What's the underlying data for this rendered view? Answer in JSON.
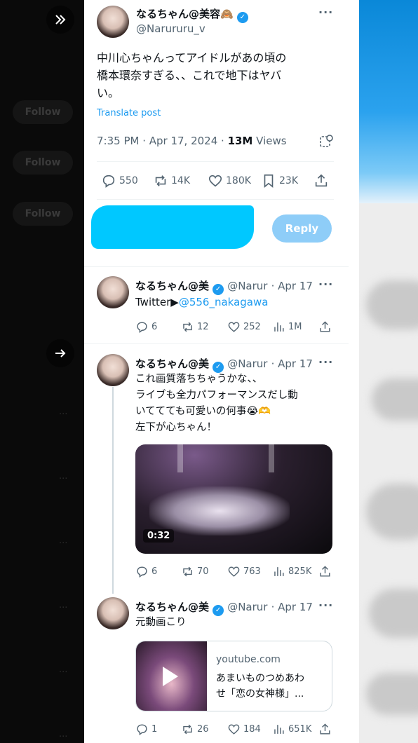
{
  "backdrop": {
    "follow_label": "Follow"
  },
  "main_tweet": {
    "display_name": "なるちゃん@美容🙈",
    "handle": "@Narururu_v",
    "text_line1": "中川心ちゃんってアイドルがあの頃の",
    "text_line2": "橋本環奈すぎる、、これで地下はヤバ",
    "text_line3": "い。",
    "translate_label": "Translate post",
    "time": "7:35 PM · Apr 17, 2024 · ",
    "views_count": "13M",
    "views_label": " Views",
    "replies": "550",
    "reposts": "14K",
    "likes": "180K",
    "bookmarks": "23K"
  },
  "composer": {
    "reply_button": "Reply"
  },
  "replies": [
    {
      "display_name": "なるちゃん@美",
      "handle": "@Narur",
      "date": "· Apr 17",
      "text_prefix": "Twitter▶",
      "text_link": "@556_nakagawa",
      "replies": "6",
      "reposts": "12",
      "likes": "252",
      "views": "1M"
    },
    {
      "display_name": "なるちゃん@美",
      "handle": "@Narur",
      "date": "· Apr 17",
      "text_lines": [
        "これ画質落ちちゃうかな、、",
        "ライブも全力パフォーマンスだし動",
        "いててても可愛いの何事😭🫶",
        "左下が心ちゃん！"
      ],
      "video_duration": "0:32",
      "replies": "6",
      "reposts": "70",
      "likes": "763",
      "views": "825K"
    },
    {
      "display_name": "なるちゃん@美",
      "handle": "@Narur",
      "date": "· Apr 17",
      "text": "元動画こり",
      "card_domain": "youtube.com",
      "card_title_line1": "あまいものつめあわ",
      "card_title_line2": "せ「恋の女神様」...",
      "replies": "1",
      "reposts": "26",
      "likes": "184",
      "views": "651K"
    }
  ],
  "icons": [
    "expand-icon",
    "arrow-right-icon",
    "verified-icon",
    "reply-icon",
    "repost-icon",
    "like-icon",
    "bookmark-icon",
    "share-icon",
    "views-icon",
    "grok-icon",
    "play-icon"
  ],
  "colors": {
    "accent": "#1d9bf0",
    "reply_button_disabled": "#8ecdf8",
    "text_secondary": "#536471"
  }
}
